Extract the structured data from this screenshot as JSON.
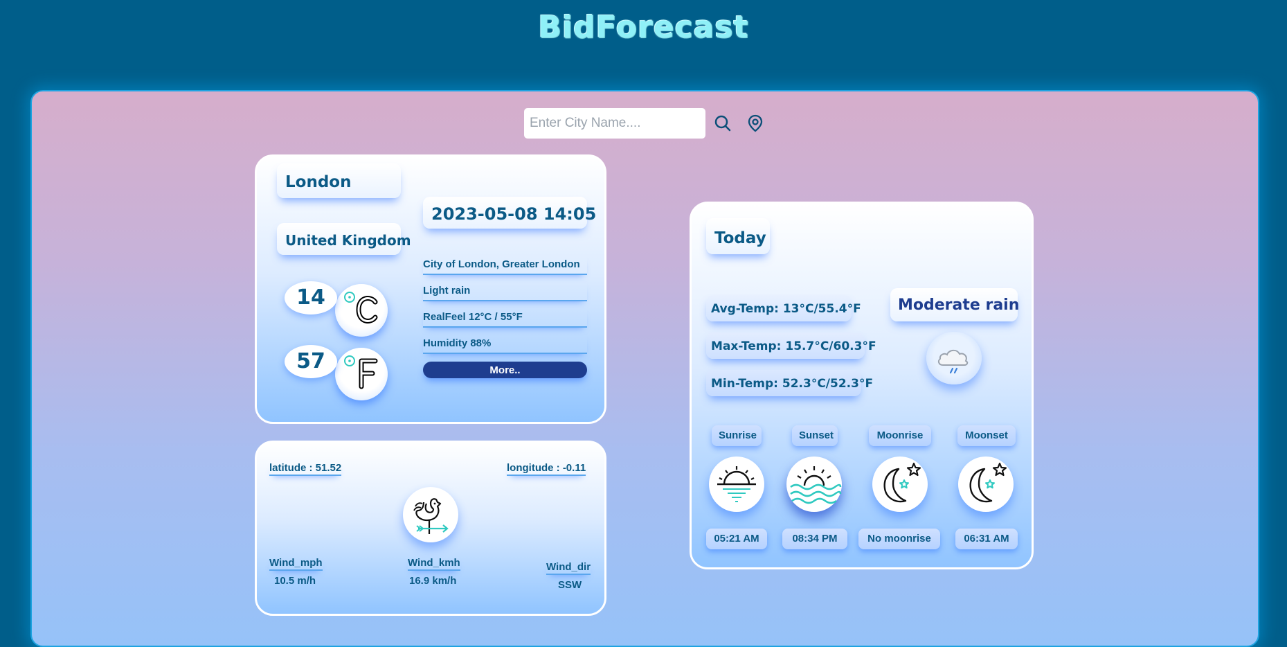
{
  "app": {
    "brand": "BidForecast"
  },
  "search": {
    "placeholder": "Enter City Name...."
  },
  "current": {
    "city": "London",
    "country": "United Kingdom",
    "datetime": "2023-05-08 14:05",
    "region": "City of London, Greater London",
    "condition": "Light rain",
    "realfeel": "RealFeel 12°C / 55°F",
    "humidity": "Humidity 88%",
    "more_label": "More..",
    "temp_c": "14",
    "temp_f": "57"
  },
  "location": {
    "latitude": "latitude : 51.52",
    "longitude": "longitude : -0.11",
    "wind_mph_label": "Wind_mph",
    "wind_mph_value": "10.5 m/h",
    "wind_kmh_label": "Wind_kmh",
    "wind_kmh_value": "16.9 km/h",
    "wind_dir_label": "Wind_dir",
    "wind_dir_value": "SSW"
  },
  "today": {
    "title": "Today",
    "avg_temp": "Avg-Temp: 13°C/55.4°F",
    "max_temp": "Max-Temp: 15.7°C/60.3°F",
    "min_temp": "Min-Temp: 52.3°C/52.3°F",
    "condition": "Moderate rain",
    "astro": [
      {
        "label": "Sunrise",
        "value": "05:21 AM",
        "icon": "sunrise-icon"
      },
      {
        "label": "Sunset",
        "value": "08:34 PM",
        "icon": "sunset-icon"
      },
      {
        "label": "Moonrise",
        "value": "No moonrise",
        "icon": "moonrise-icon"
      },
      {
        "label": "Moonset",
        "value": "06:31 AM",
        "icon": "moonset-icon"
      }
    ]
  },
  "colors": {
    "background": "#005e8a",
    "brand": "#8ff0f7",
    "text_primary": "#0b5a86",
    "button": "#1e3d8f"
  }
}
